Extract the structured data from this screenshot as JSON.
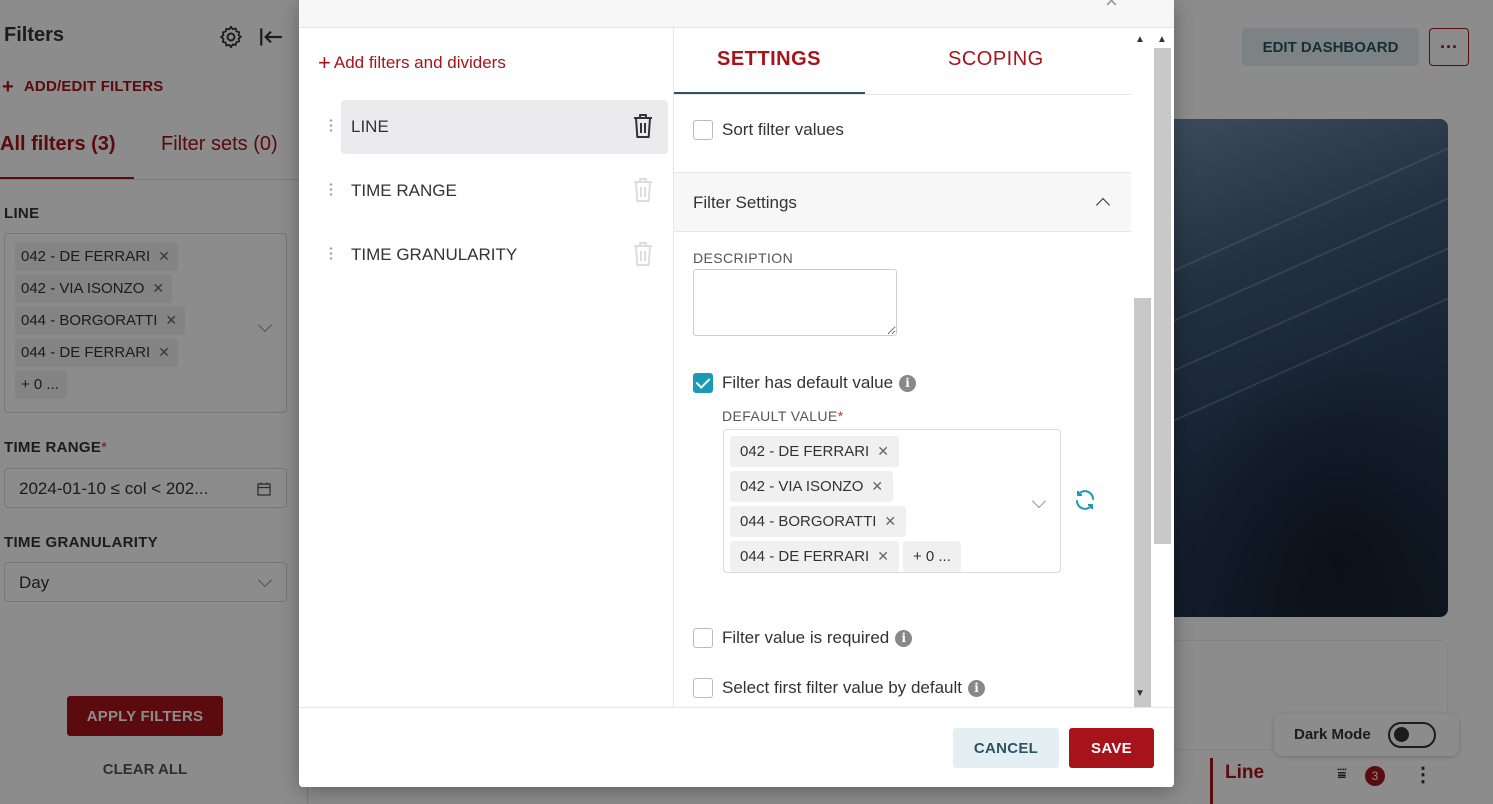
{
  "left_panel": {
    "title": "Filters",
    "add_edit": "ADD/EDIT FILTERS",
    "tabs": [
      "All filters (3)",
      "Filter sets (0)"
    ],
    "filters": {
      "line": {
        "label": "LINE",
        "tags": [
          "042 - DE FERRARI",
          "042 - VIA ISONZO",
          "044 - BORGORATTI",
          "044 - DE FERRARI"
        ],
        "more": "+ 0 ..."
      },
      "time_range": {
        "label": "TIME RANGE",
        "value": "2024-01-10 ≤ col < 202..."
      },
      "time_granularity": {
        "label": "TIME GRANULARITY",
        "value": "Day"
      }
    },
    "apply": "APPLY FILTERS",
    "clear": "CLEAR ALL"
  },
  "dashboard": {
    "edit": "EDIT DASHBOARD",
    "more": "···",
    "dark_mode": "Dark Mode",
    "card_title": "Line",
    "card_badge": "3"
  },
  "modal": {
    "close": "×",
    "add_filters": "Add filters and dividers",
    "items": [
      "LINE",
      "TIME RANGE",
      "TIME GRANULARITY"
    ],
    "tabs": {
      "settings": "SETTINGS",
      "scoping": "SCOPING"
    },
    "sort_filter_values": "Sort filter values",
    "filter_settings": "Filter Settings",
    "description_label": "DESCRIPTION",
    "has_default": "Filter has default value",
    "default_value_label": "DEFAULT VALUE",
    "default_tags": [
      "042 - DE FERRARI",
      "042 - VIA ISONZO",
      "044 - BORGORATTI",
      "044 - DE FERRARI"
    ],
    "default_more": "+ 0 ...",
    "value_required": "Filter value is required",
    "select_first": "Select first filter value by default",
    "cancel": "CANCEL",
    "save": "SAVE"
  },
  "colors": {
    "brand": "#a6131b",
    "accent": "#1a9ab7",
    "secondary": "#2d5560"
  }
}
